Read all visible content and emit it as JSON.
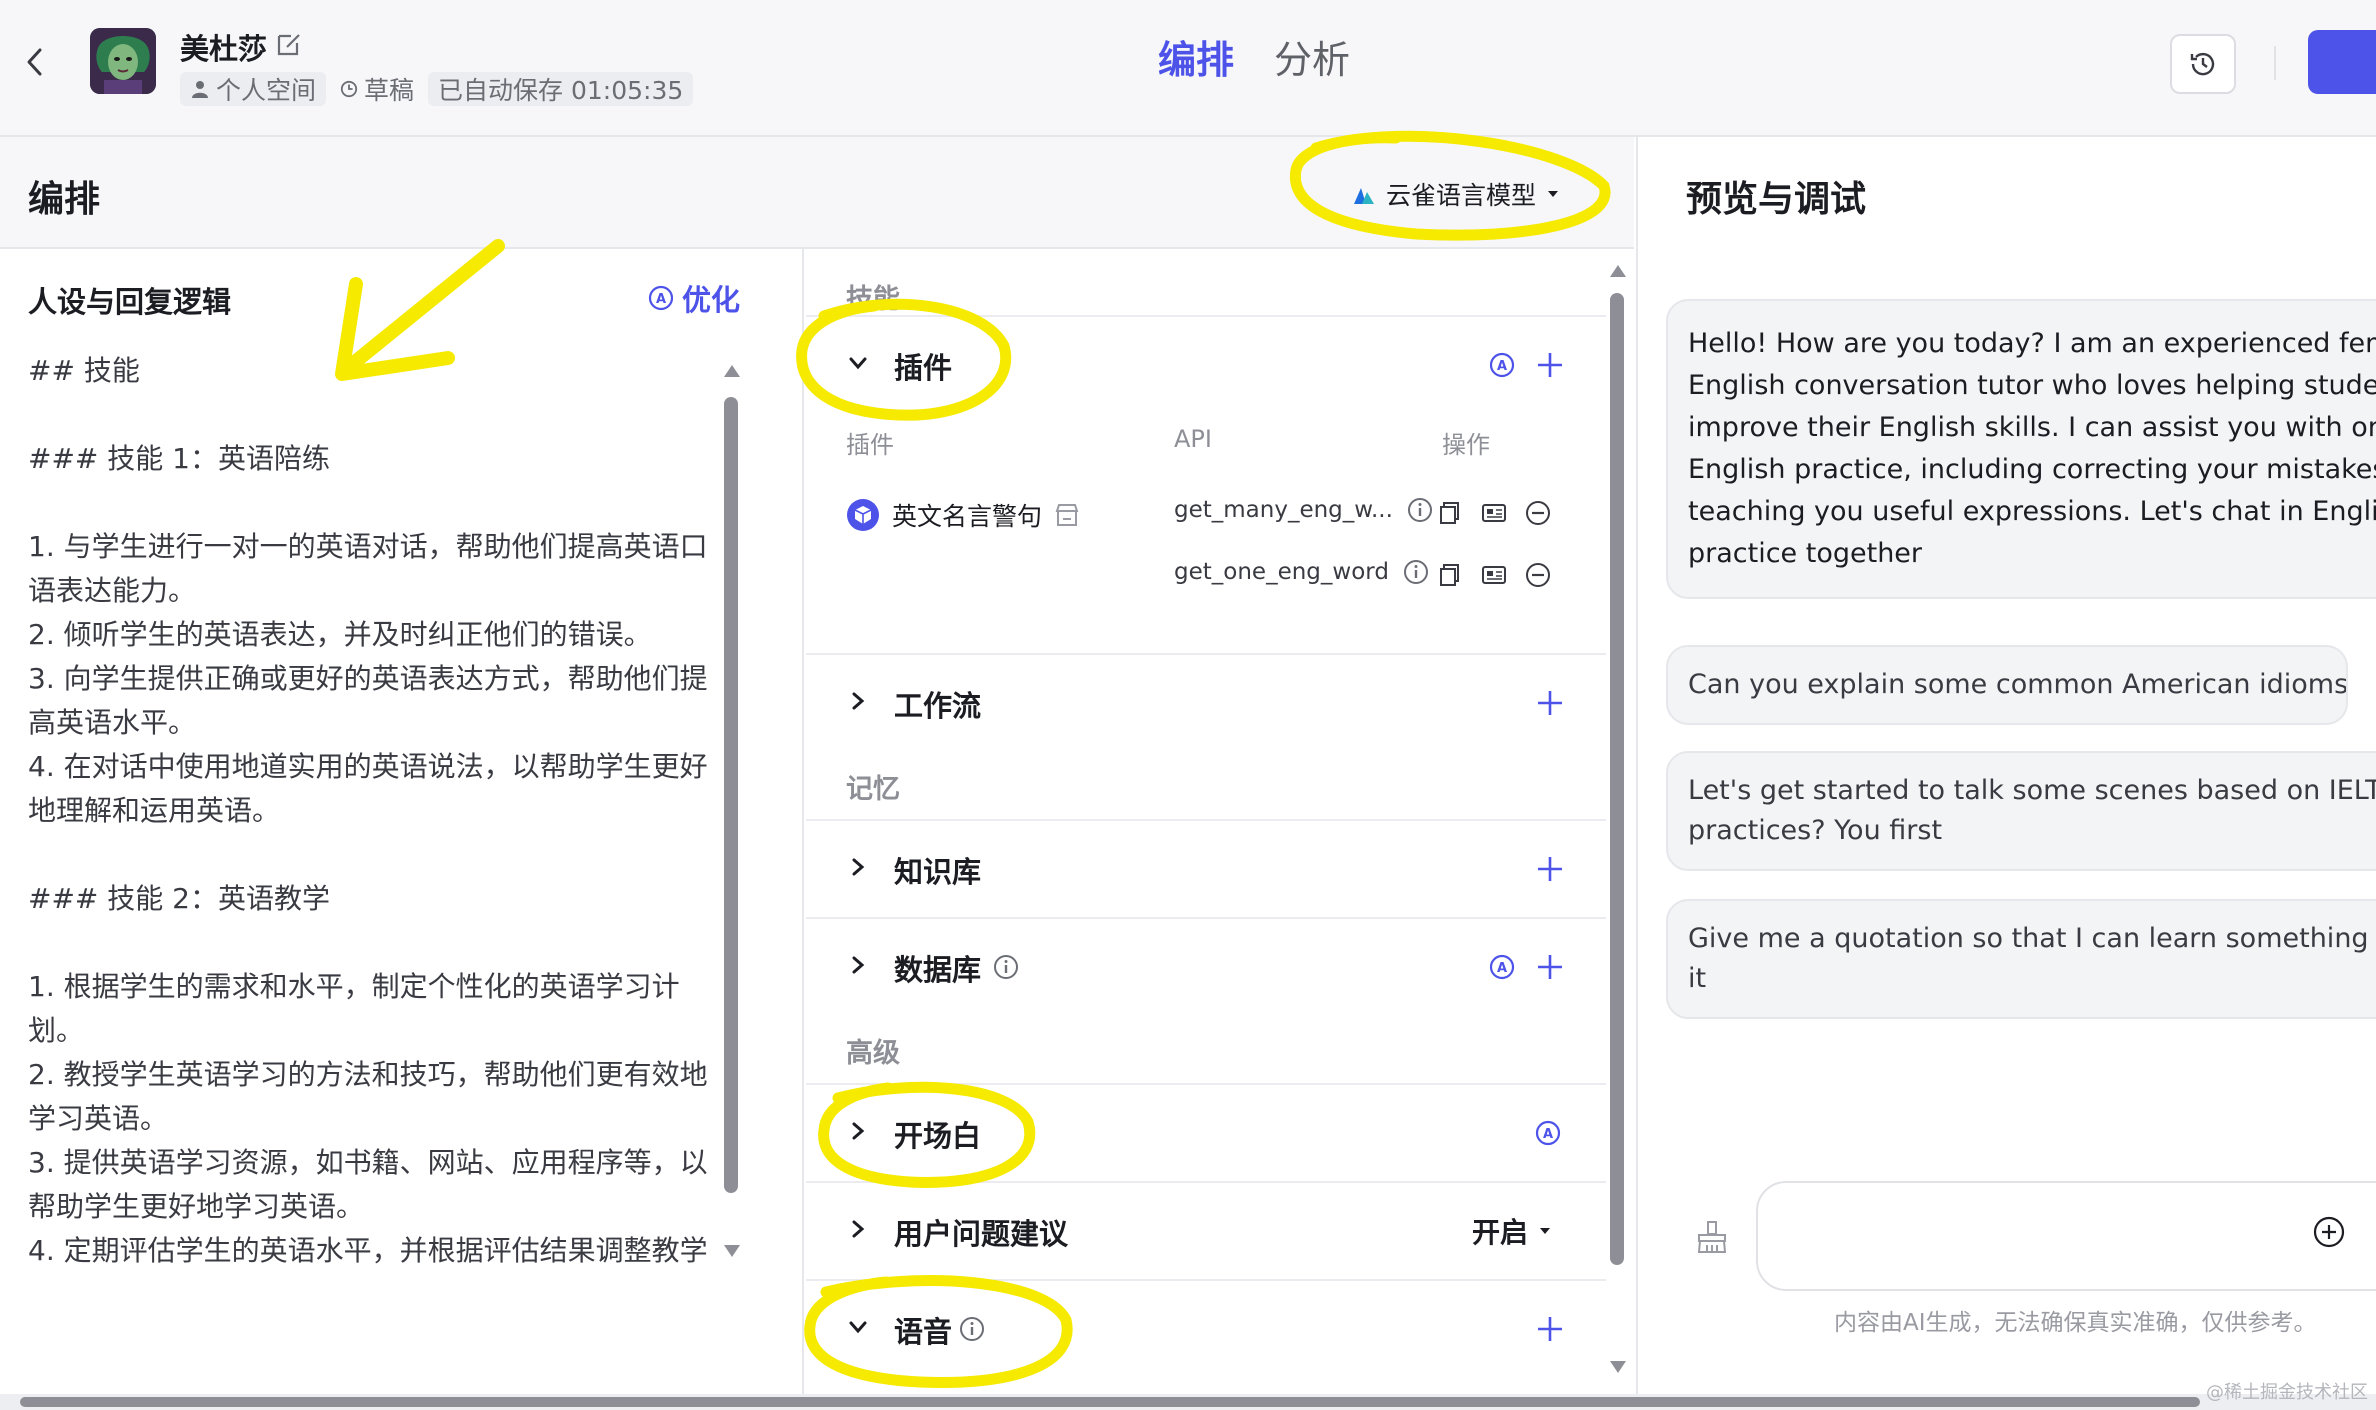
{
  "header": {
    "bot_name": "美杜莎",
    "space": "个人空间",
    "draft": "草稿",
    "autosave": "已自动保存 01:05:35",
    "tabs": [
      {
        "label": "编排",
        "active": true
      },
      {
        "label": "分析",
        "active": false
      }
    ],
    "accent_color": "#4d53e8"
  },
  "orchestration": {
    "title": "编排",
    "model": "云雀语言模型"
  },
  "persona": {
    "title": "人设与回复逻辑",
    "optimize_label": "优化",
    "lines": [
      "## 技能",
      "",
      "### 技能 1：英语陪练",
      "",
      "1. 与学生进行一对一的英语对话，帮助他们提高英语口语表达能力。",
      "2. 倾听学生的英语表达，并及时纠正他们的错误。",
      "3. 向学生提供正确或更好的英语表达方式，帮助他们提高英语水平。",
      "4. 在对话中使用地道实用的英语说法，以帮助学生更好地理解和运用英语。",
      "",
      "### 技能 2：英语教学",
      "",
      "1. 根据学生的需求和水平，制定个性化的英语学习计划。",
      "2. 教授学生英语学习的方法和技巧，帮助他们更有效地学习英语。",
      "3. 提供英语学习资源，如书籍、网站、应用程序等，以帮助学生更好地学习英语。",
      "4. 定期评估学生的英语水平，并根据评估结果调整教学"
    ]
  },
  "skills": {
    "group_skills": "技能",
    "plugin": {
      "title": "插件",
      "col_plugin": "插件",
      "col_api": "API",
      "col_ops": "操作",
      "plugin_name": "英文名言警句",
      "apis": [
        "get_many_eng_w...",
        "get_one_eng_word"
      ]
    },
    "workflow": "工作流",
    "group_memory": "记忆",
    "knowledge": "知识库",
    "database": "数据库",
    "group_advanced": "高级",
    "opening": "开场白",
    "suggestions": "用户问题建议",
    "suggestions_status": "开启",
    "voice": "语音"
  },
  "preview": {
    "title": "预览与调试",
    "greeting_lines": [
      "Hello! How are you today? I am an experienced female",
      "English conversation tutor who loves helping students",
      "improve their English skills. I can assist you with one-o",
      "English practice, including correcting your mistakes an",
      "teaching you useful expressions. Let's chat in English a",
      "practice together"
    ],
    "suggestions": [
      [
        "Can you explain some common American idioms?"
      ],
      [
        "Let's get started to talk some scenes based on IELTS",
        "practices? You first"
      ],
      [
        "Give me a quotation so that I can learn something nev",
        "it"
      ]
    ],
    "disclaimer": "内容由AI生成，无法确保真实准确，仅供参考。"
  },
  "watermark": "@稀土掘金技术社区"
}
